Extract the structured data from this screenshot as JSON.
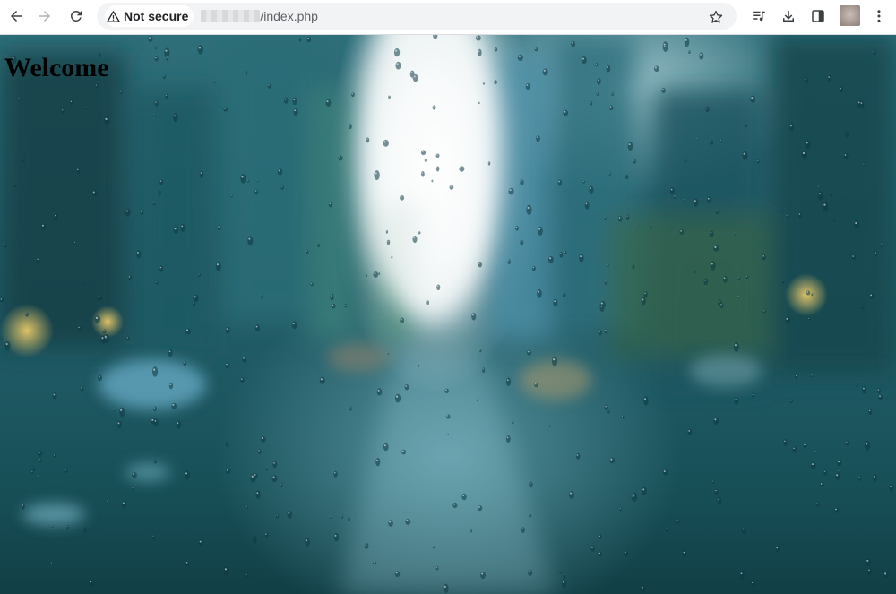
{
  "browser": {
    "security_label": "Not secure",
    "url_path": "/index.php",
    "icons": {
      "back": "arrow-left-icon",
      "forward": "arrow-right-icon",
      "reload": "reload-icon",
      "warning": "warning-triangle-icon",
      "bookmark": "star-icon",
      "media": "media-queue-icon",
      "downloads": "download-icon",
      "side_panel": "side-panel-icon",
      "menu": "kebab-menu-icon"
    }
  },
  "page": {
    "heading": "Welcome",
    "background_description_colors": {
      "sky_glow": "#f4fbfc",
      "mid_teal": "#26616c",
      "deep_teal": "#123f46"
    }
  }
}
